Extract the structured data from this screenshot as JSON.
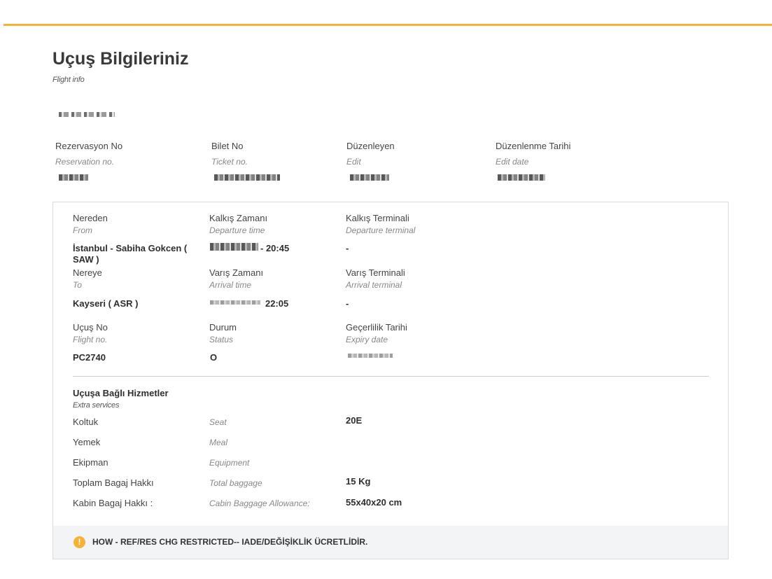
{
  "accent_color": "#f5b335",
  "page": {
    "title": "Uçuş Bilgileriniz",
    "subtitle": "Flight info"
  },
  "ticket_header": {
    "reservation": {
      "label": "Rezervasyon No",
      "label_en": "Reservation no."
    },
    "ticket": {
      "label": "Bilet No",
      "label_en": "Ticket no."
    },
    "editor": {
      "label": "Düzenleyen",
      "label_en": "Edit"
    },
    "edit_date": {
      "label": "Düzenlenme Tarihi",
      "label_en": "Edit date"
    }
  },
  "flight": {
    "from": {
      "label": "Nereden",
      "label_en": "From",
      "value": "İstanbul - Sabiha Gokcen ( SAW )"
    },
    "departure_time": {
      "label": "Kalkış Zamanı",
      "label_en": "Departure time",
      "value": "- 20:45"
    },
    "departure_terminal": {
      "label": "Kalkış Terminali",
      "label_en": "Departure terminal",
      "value": "-"
    },
    "to": {
      "label": "Nereye",
      "label_en": "To",
      "value": "Kayseri ( ASR )"
    },
    "arrival_time": {
      "label": "Varış Zamanı",
      "label_en": "Arrival time",
      "value": "22:05"
    },
    "arrival_terminal": {
      "label": "Varış Terminali",
      "label_en": "Arrival terminal",
      "value": "-"
    },
    "flight_no": {
      "label": "Uçuş No",
      "label_en": "Flight no.",
      "value": "PC2740"
    },
    "status": {
      "label": "Durum",
      "label_en": "Status",
      "value": "O"
    },
    "expiry": {
      "label": "Geçerlilik Tarihi",
      "label_en": "Expiry date"
    }
  },
  "extra_services": {
    "title": "Uçuşa Bağlı Hizmetler",
    "subtitle": "Extra services",
    "items": [
      {
        "label": "Koltuk",
        "label_en": "Seat",
        "value": "20E"
      },
      {
        "label": "Yemek",
        "label_en": "Meal",
        "value": ""
      },
      {
        "label": "Ekipman",
        "label_en": "Equipment",
        "value": ""
      },
      {
        "label": "Toplam Bagaj Hakkı",
        "label_en": "Total baggage",
        "value": "15 Kg"
      },
      {
        "label": "Kabin Bagaj Hakkı :",
        "label_en": "Cabin Baggage Allowance:",
        "value": "55x40x20 cm"
      }
    ]
  },
  "notice": {
    "icon": "warning-icon",
    "icon_glyph": "!",
    "text": "HOW - REF/RES CHG RESTRICTED-- IADE/DEĞİŞİKLİK ÜCRETLİDİR."
  }
}
